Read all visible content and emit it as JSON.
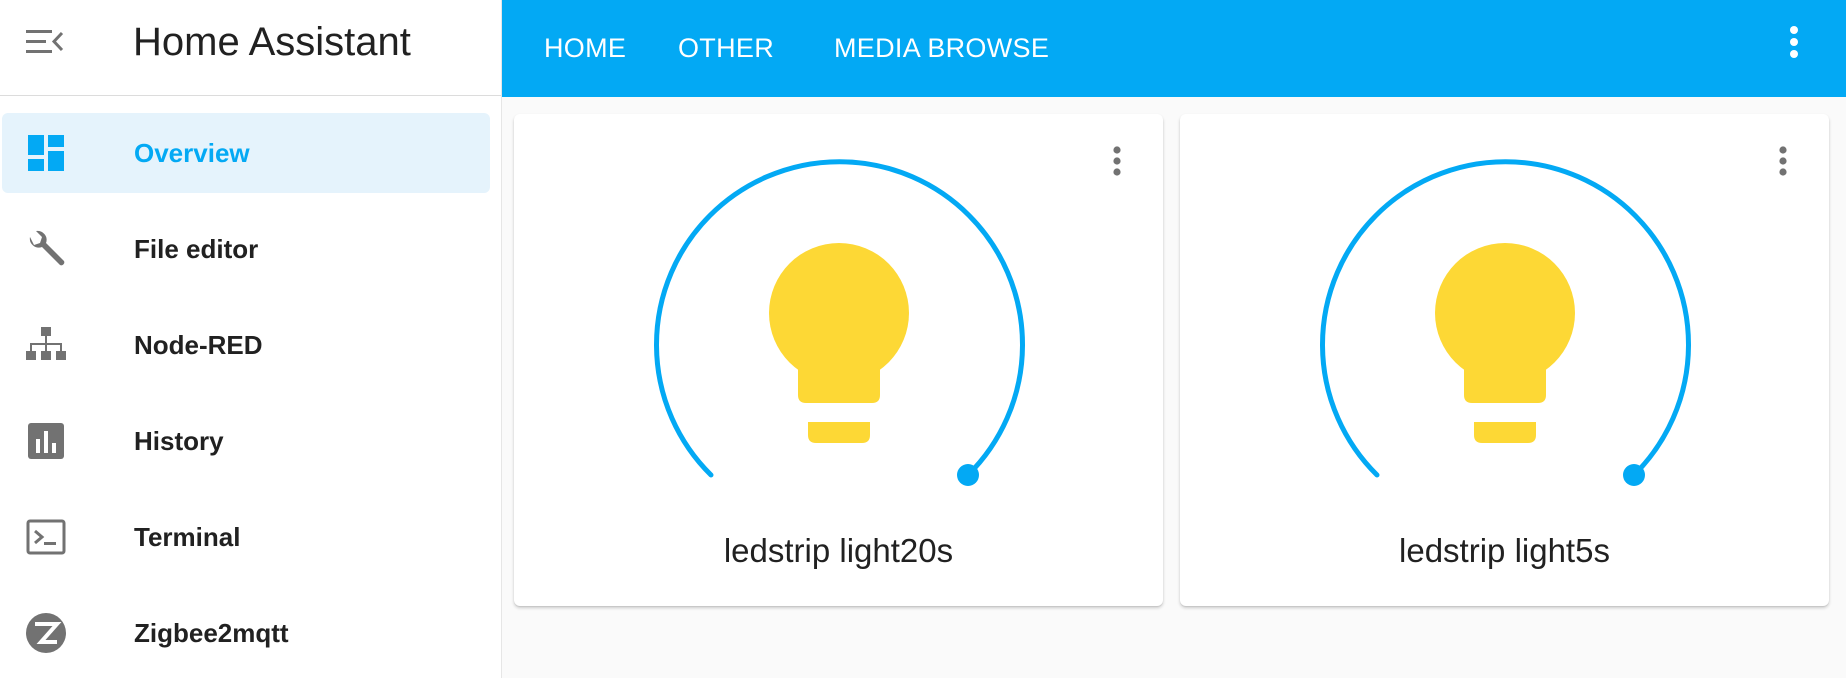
{
  "sidebar": {
    "title": "Home Assistant",
    "items": [
      {
        "label": "Overview",
        "icon": "view-dashboard-icon",
        "active": true
      },
      {
        "label": "File editor",
        "icon": "wrench-icon",
        "active": false
      },
      {
        "label": "Node-RED",
        "icon": "sitemap-icon",
        "active": false
      },
      {
        "label": "History",
        "icon": "chart-box-icon",
        "active": false
      },
      {
        "label": "Terminal",
        "icon": "console-icon",
        "active": false
      },
      {
        "label": "Zigbee2mqtt",
        "icon": "zigbee-icon",
        "active": false
      }
    ]
  },
  "topbar": {
    "tabs": [
      {
        "label": "HOME"
      },
      {
        "label": "OTHER"
      },
      {
        "label": "MEDIA BROWSE"
      }
    ]
  },
  "cards": [
    {
      "name": "ledstrip light20s",
      "brightness_position": "max"
    },
    {
      "name": "ledstrip light5s",
      "brightness_position": "max"
    }
  ],
  "colors": {
    "accent": "#03a9f4",
    "bulb": "#fdd835",
    "active_nav_bg": "#e5f3fc",
    "icon_gray": "#727272"
  }
}
